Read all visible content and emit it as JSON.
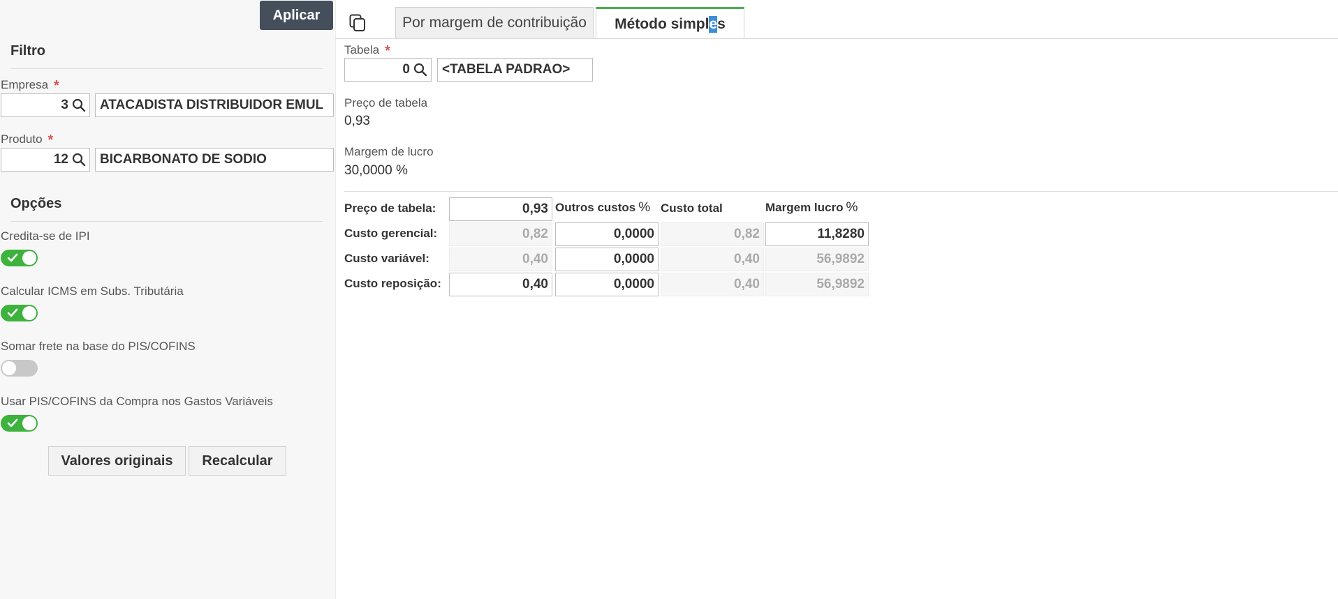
{
  "sidebar": {
    "apply_label": "Aplicar",
    "filter_title": "Filtro",
    "empresa": {
      "label": "Empresa",
      "required": "*",
      "code": "3",
      "name": "ATACADISTA DISTRIBUIDOR EMUL"
    },
    "produto": {
      "label": "Produto",
      "required": "*",
      "code": "12",
      "name": "BICARBONATO DE SODIO"
    },
    "options_title": "Opções",
    "options": [
      {
        "label": "Credita-se de IPI",
        "enabled": true
      },
      {
        "label": "Calcular ICMS em Subs. Tributária",
        "enabled": true
      },
      {
        "label": "Somar frete na base do PIS/COFINS",
        "enabled": false
      },
      {
        "label": "Usar PIS/COFINS da Compra nos Gastos Variáveis",
        "enabled": true
      }
    ],
    "original_values_label": "Valores originais",
    "recalc_label": "Recalcular"
  },
  "tabs": [
    {
      "label": "Por margem de contribuição",
      "active": false
    },
    {
      "label_before": "Método simpl",
      "label_selected": "e",
      "label_after": "s",
      "active": true
    }
  ],
  "main": {
    "tabela": {
      "label": "Tabela",
      "required": "*",
      "code": "0",
      "name": "<TABELA PADRAO>"
    },
    "preco_tabela": {
      "label": "Preço de tabela",
      "value": "0,93"
    },
    "margem_lucro": {
      "label": "Margem de lucro",
      "value": "30,0000 %"
    },
    "grid": {
      "headers": {
        "outros": "Outros custos",
        "outros_unit": "%",
        "total": "Custo total",
        "margem": "Margem lucro",
        "margem_unit": "%"
      },
      "row_preco": {
        "label": "Preço de tabela:",
        "value": "0,93"
      },
      "rows": [
        {
          "label": "Custo gerencial:",
          "custo": "0,82",
          "outros": "0,0000",
          "total": "0,82",
          "margem": "11,8280"
        },
        {
          "label": "Custo variável:",
          "custo": "0,40",
          "outros": "0,0000",
          "total": "0,40",
          "margem": "56,9892"
        },
        {
          "label": "Custo reposição:",
          "custo": "0,40",
          "outros": "0,0000",
          "total": "0,40",
          "margem": "56,9892"
        }
      ]
    }
  },
  "colors": {
    "accent_green": "#3db23d",
    "tab_active_border": "#4caf50",
    "apply_bg": "#454f5b",
    "required": "#d9534f"
  }
}
